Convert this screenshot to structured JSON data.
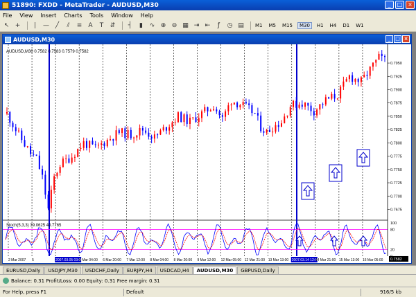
{
  "window": {
    "title": "51890: FXDD - MetaTrader - AUDUSD,M30"
  },
  "menu": [
    "File",
    "View",
    "Insert",
    "Charts",
    "Tools",
    "Window",
    "Help"
  ],
  "toolbar": {
    "timeframes": [
      "M1",
      "M5",
      "M15",
      "M30",
      "H1",
      "H4",
      "D1",
      "W1"
    ],
    "active_timeframe": "M30"
  },
  "chart": {
    "window_title": "AUDUSD,M30",
    "info": "AUDUSD,M30  0.7582  0.7583  0.7579  0.7582",
    "current_price": "0.7582",
    "price_ticks": [
      "0.7950",
      "0.7925",
      "0.7900",
      "0.7875",
      "0.7850",
      "0.7825",
      "0.7800",
      "0.7775",
      "0.7750",
      "0.7725",
      "0.7700",
      "0.7675"
    ],
    "stoch_label": "Stoch(5,3,3) 39.0625 40.7765",
    "stoch_ticks": [
      "100",
      "80",
      "20",
      "0"
    ],
    "time_ticks": [
      "2 Mar 2007",
      "5",
      "2007.03.05 03:00",
      "6 Mar 04:00",
      "6 Mar 20:00",
      "7 Mar 12:00",
      "8 Mar 04:00",
      "8 Mar 20:00",
      "9 Mar 12:00",
      "12 Mar 05:00",
      "12 Mar 21:00",
      "13 Mar 13:00",
      "2007.03.14 12:00",
      "14 Mar 21:00",
      "15 Mar 13:00",
      "16 Mar 05:00"
    ]
  },
  "symbol_tabs": [
    "EURUSD,Daily",
    "USDJPY,M30",
    "USDCHF,Daily",
    "EURJPY,H4",
    "USDCAD,H4",
    "AUDUSD,M30",
    "GBPUSD,Daily"
  ],
  "active_tab": "AUDUSD,M30",
  "terminal": {
    "summary": "Balance: 0.31  Profit/Loss: 0.00  Equity: 0.31  Free margin: 0.31"
  },
  "status": {
    "help": "For Help, press F1",
    "profile": "Default",
    "traffic": "916/5 kb"
  },
  "chart_data": {
    "type": "candlestick",
    "symbol": "AUDUSD",
    "timeframe": "M30",
    "price_range": [
      0.766,
      0.798
    ],
    "close_path": [
      [
        0,
        0.7855
      ],
      [
        4,
        0.7815
      ],
      [
        8,
        0.778
      ],
      [
        10,
        0.777
      ],
      [
        12,
        0.7735
      ],
      [
        14,
        0.7675
      ],
      [
        16,
        0.7735
      ],
      [
        18,
        0.776
      ],
      [
        22,
        0.7775
      ],
      [
        26,
        0.78
      ],
      [
        30,
        0.779
      ],
      [
        34,
        0.7805
      ],
      [
        38,
        0.782
      ],
      [
        42,
        0.7815
      ],
      [
        46,
        0.7825
      ],
      [
        50,
        0.781
      ],
      [
        54,
        0.783
      ],
      [
        58,
        0.785
      ],
      [
        62,
        0.784
      ],
      [
        66,
        0.7855
      ],
      [
        70,
        0.787
      ],
      [
        73,
        0.7845
      ],
      [
        76,
        0.788
      ],
      [
        80,
        0.787
      ],
      [
        84,
        0.7855
      ],
      [
        86,
        0.783
      ],
      [
        88,
        0.782
      ],
      [
        90,
        0.783
      ],
      [
        93,
        0.784
      ],
      [
        96,
        0.787
      ],
      [
        100,
        0.7875
      ],
      [
        104,
        0.786
      ],
      [
        108,
        0.788
      ],
      [
        112,
        0.789
      ],
      [
        116,
        0.7925
      ],
      [
        120,
        0.7915
      ],
      [
        124,
        0.7945
      ],
      [
        126,
        0.796
      ],
      [
        128,
        0.7955
      ]
    ],
    "arrow_annotations": 4,
    "stochastic": {
      "name": "Stoch(5,3,3)",
      "main": 39.0625,
      "signal": 40.7765,
      "levels": [
        20,
        80
      ],
      "range": [
        0,
        100
      ]
    }
  },
  "colors": {
    "bull_candle": "#ff0000",
    "bear_candle": "#0000ff",
    "stoch_main": "#0000ff",
    "stoch_signal": "#ff0000",
    "level_lines": "#ff00ff",
    "marker_lines": "#0000cc"
  }
}
